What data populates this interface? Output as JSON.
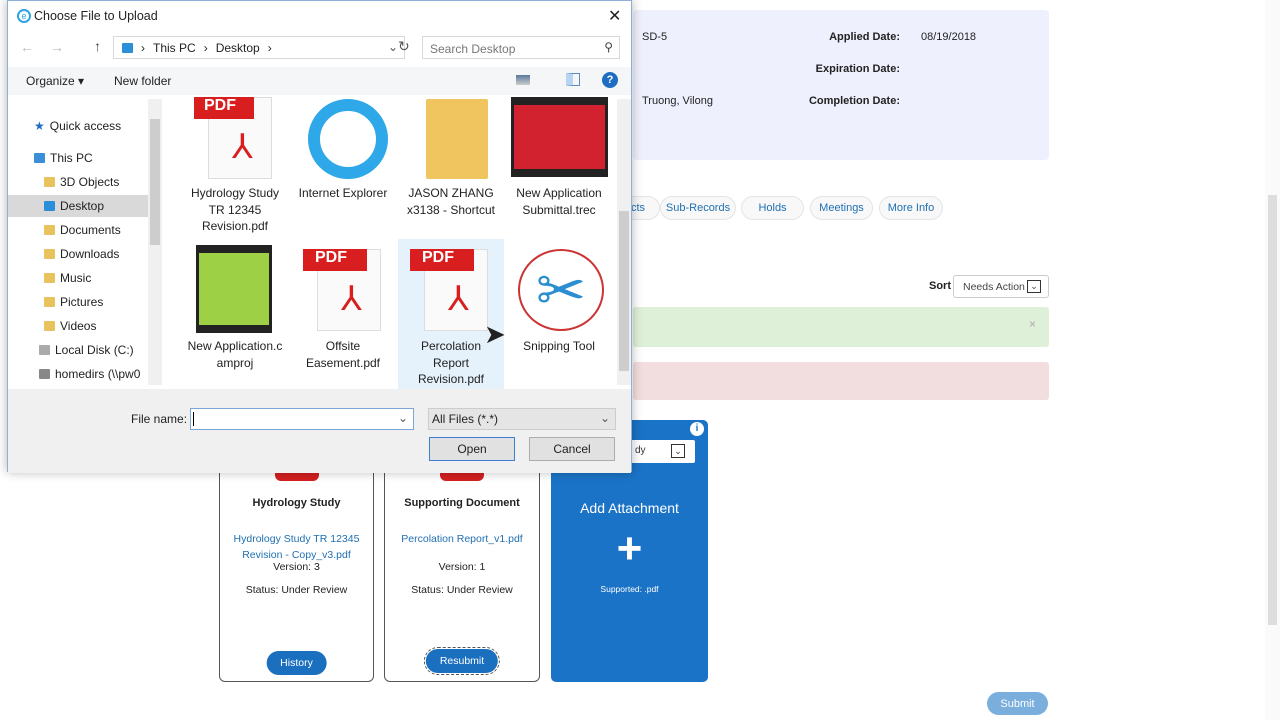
{
  "record": {
    "id": "SD-5",
    "assigned": "Truong, Vilong",
    "applied_label": "Applied Date:",
    "applied": "08/19/2018",
    "expiration_label": "Expiration Date:",
    "completion_label": "Completion Date:"
  },
  "tabs": [
    "cts",
    "Sub-Records",
    "Holds",
    "Meetings",
    "More Info"
  ],
  "sort": {
    "label": "Sort",
    "value": "Needs Action"
  },
  "alert_close": "×",
  "cards": [
    {
      "title": "Hydrology Study",
      "file": "Hydrology Study TR 12345 Revision - Copy_v3.pdf",
      "version": "Version: 3",
      "status": "Status: Under Review",
      "button": "History"
    },
    {
      "title": "Supporting Document",
      "file": "Percolation Report_v1.pdf",
      "version": "Version: 1",
      "status": "Status: Under Review",
      "button": "Resubmit"
    }
  ],
  "add": {
    "select_value": "dy",
    "title": "Add Attachment",
    "plus": "+",
    "supported": "Supported: .pdf",
    "info": "i"
  },
  "submit": "Submit",
  "dialog": {
    "title": "Choose File to Upload",
    "close": "✕",
    "breadcrumb": [
      "This PC",
      "Desktop"
    ],
    "search_placeholder": "Search Desktop",
    "organize": "Organize ▾",
    "new_folder": "New folder",
    "nav": [
      "Quick access",
      "This PC",
      "3D Objects",
      "Desktop",
      "Documents",
      "Downloads",
      "Music",
      "Pictures",
      "Videos",
      "Local Disk (C:)",
      "homedirs (\\\\pw0"
    ],
    "files": [
      "Hydrology Study TR 12345 Revision.pdf",
      "Internet Explorer",
      "JASON ZHANG x3138 - Shortcut",
      "New Application Submittal.trec",
      "New Application.camproj",
      "Offsite Easement.pdf",
      "Percolation Report Revision.pdf",
      "Snipping Tool"
    ],
    "pdf_badge": "PDF",
    "filename_label": "File name:",
    "filename_value": "",
    "filetype": "All Files (*.*)",
    "open": "Open",
    "cancel": "Cancel"
  }
}
